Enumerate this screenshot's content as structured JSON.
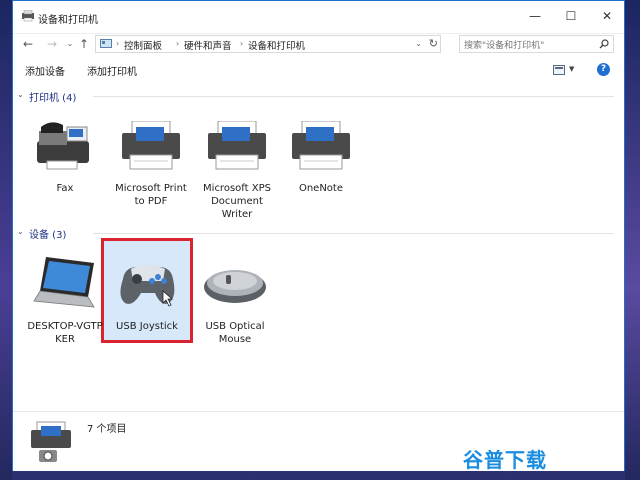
{
  "window": {
    "title": "设备和打印机",
    "controls": {
      "minimize": "—",
      "maximize": "☐",
      "close": "✕"
    }
  },
  "address_bar": {
    "breadcrumbs": [
      "控制面板",
      "硬件和声音",
      "设备和打印机"
    ],
    "search_placeholder": "搜索\"设备和打印机\""
  },
  "toolbar": {
    "add_device": "添加设备",
    "add_printer": "添加打印机",
    "help": "?"
  },
  "sections": {
    "printers": {
      "title": "打印机 (4)",
      "items": [
        {
          "label": "Fax",
          "icon": "fax-icon"
        },
        {
          "label": "Microsoft Print\nto PDF",
          "icon": "printer-icon"
        },
        {
          "label": "Microsoft XPS\nDocument\nWriter",
          "icon": "printer-icon"
        },
        {
          "label": "OneNote",
          "icon": "printer-icon"
        }
      ]
    },
    "devices": {
      "title": "设备 (3)",
      "items": [
        {
          "label": "DESKTOP-VGTP\nKER",
          "icon": "laptop-icon"
        },
        {
          "label": "USB Joystick",
          "icon": "gamepad-icon",
          "selected": true
        },
        {
          "label": "USB Optical\nMouse",
          "icon": "mouse-icon"
        }
      ]
    }
  },
  "status_bar": {
    "count": "7 个项目"
  },
  "watermark": "谷普下载",
  "colors": {
    "accent": "#1f6fd0",
    "selection": "#d9232f",
    "section_title": "#1e3287"
  }
}
